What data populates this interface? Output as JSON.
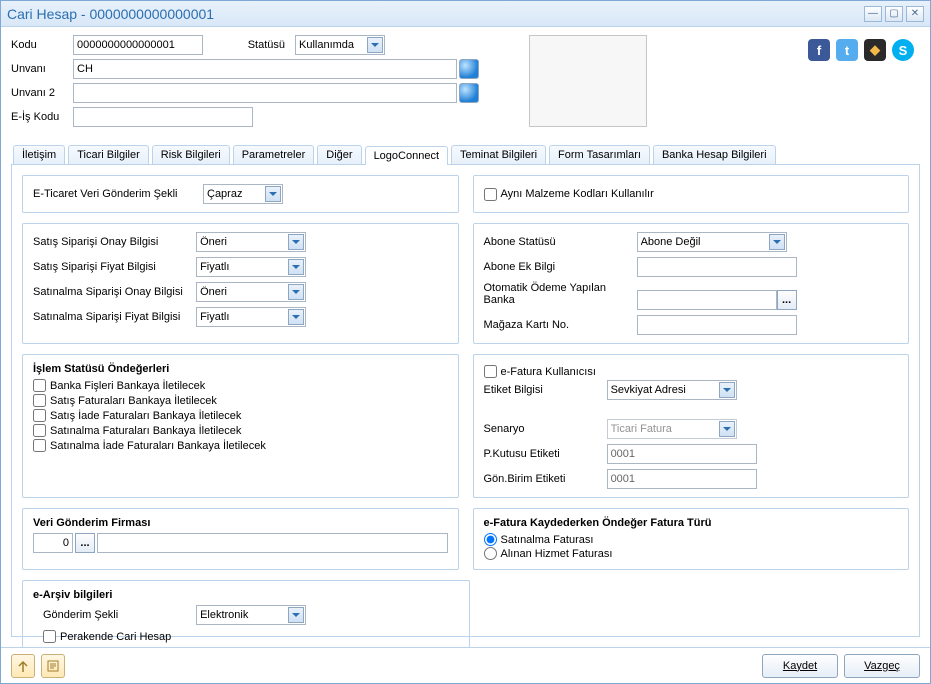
{
  "window": {
    "title": "Cari Hesap - 0000000000000001"
  },
  "header": {
    "kodu_label": "Kodu",
    "kodu": "0000000000000001",
    "statusu_label": "Statüsü",
    "statusu": "Kullanımda",
    "unvani_label": "Unvanı",
    "unvani": "CH",
    "unvani2_label": "Unvanı 2",
    "unvani2": "",
    "eis_kodu_label": "E-İş Kodu",
    "eis_kodu": ""
  },
  "tabs": [
    "İletişim",
    "Ticari Bilgiler",
    "Risk Bilgileri",
    "Parametreler",
    "Diğer",
    "LogoConnect",
    "Teminat Bilgileri",
    "Form Tasarımları",
    "Banka Hesap Bilgileri"
  ],
  "active_tab": "LogoConnect",
  "lc": {
    "eticaret_label": "E-Ticaret Veri Gönderim Şekli",
    "eticaret": "Çapraz",
    "ayni_malzeme": "Aynı Malzeme Kodları Kullanılır",
    "sso_label": "Satış Siparişi Onay Bilgisi",
    "sso": "Öneri",
    "ssf_label": "Satış Siparişi Fiyat Bilgisi",
    "ssf": "Fiyatlı",
    "saso_label": "Satınalma Siparişi Onay Bilgisi",
    "saso": "Öneri",
    "sasf_label": "Satınalma Siparişi Fiyat Bilgisi",
    "sasf": "Fiyatlı",
    "abone_statusu_label": "Abone Statüsü",
    "abone_statusu": "Abone Değil",
    "abone_ek_label": "Abone Ek Bilgi",
    "abone_ek": "",
    "otomatik_odeme_label": "Otomatik Ödeme Yapılan Banka",
    "otomatik_odeme": "",
    "magaza_karti_label": "Mağaza Kartı No.",
    "magaza_karti": "",
    "islem_statu_title": "İşlem Statüsü Öndeğerleri",
    "islem_items": [
      "Banka Fişleri Bankaya İletilecek",
      "Satış Faturaları Bankaya İletilecek",
      "Satış İade Faturaları Bankaya İletilecek",
      "Satınalma Faturaları Bankaya İletilecek",
      "Satınalma İade Faturaları Bankaya İletilecek"
    ],
    "efatura_kullanici": "e-Fatura Kullanıcısı",
    "etiket_bilgisi_label": "Etiket Bilgisi",
    "etiket_bilgisi": "Sevkiyat Adresi",
    "senaryo_label": "Senaryo",
    "senaryo": "Ticari Fatura",
    "pkutu_label": "P.Kutusu Etiketi",
    "pkutu": "0001",
    "gon_label": "Gön.Birim Etiketi",
    "gon": "0001",
    "veri_gonderim_title": "Veri Gönderim Firması",
    "veri_gonderim_num": "0",
    "veri_gonderim_text": "",
    "efatura_kayit_title": "e-Fatura Kaydederken Öndeğer Fatura Türü",
    "radio1": "Satınalma Faturası",
    "radio2": "Alınan Hizmet Faturası",
    "earsiv_title": "e-Arşiv bilgileri",
    "gonderim_sekli_label": "Gönderim Şekli",
    "gonderim_sekli": "Elektronik",
    "perakende": "Perakende Cari Hesap"
  },
  "footer": {
    "save": "Kaydet",
    "cancel": "Vazgeç"
  }
}
